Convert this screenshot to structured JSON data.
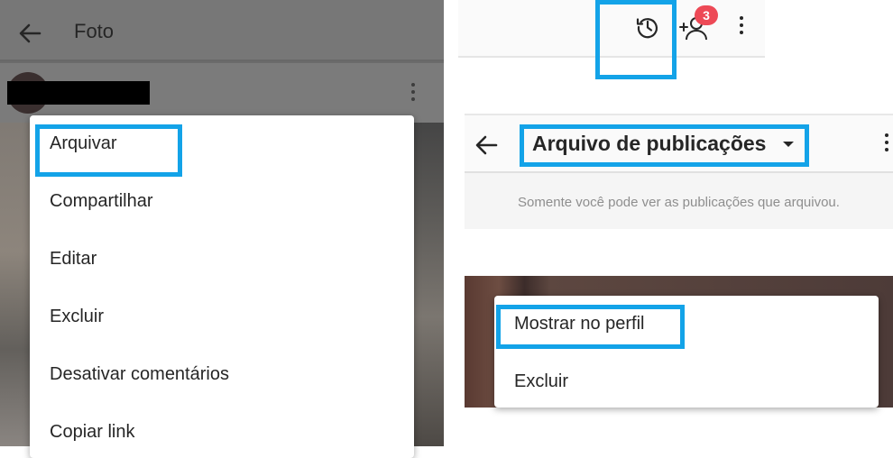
{
  "left": {
    "header": {
      "title": "Foto"
    },
    "menu": {
      "items": [
        {
          "label": "Arquivar"
        },
        {
          "label": "Compartilhar"
        },
        {
          "label": "Editar"
        },
        {
          "label": "Excluir"
        },
        {
          "label": "Desativar comentários"
        },
        {
          "label": "Copiar link"
        }
      ]
    }
  },
  "right": {
    "topbar": {
      "notification_count": "3"
    },
    "archive": {
      "title": "Arquivo de publicações",
      "info": "Somente você pode ver as publicações que arquivou."
    },
    "menu": {
      "items": [
        {
          "label": "Mostrar no perfil"
        },
        {
          "label": "Excluir"
        }
      ]
    }
  },
  "colors": {
    "highlight": "#13a3e8",
    "badge": "#ed4956",
    "text": "#262626",
    "muted_text": "#8e8e8e"
  }
}
